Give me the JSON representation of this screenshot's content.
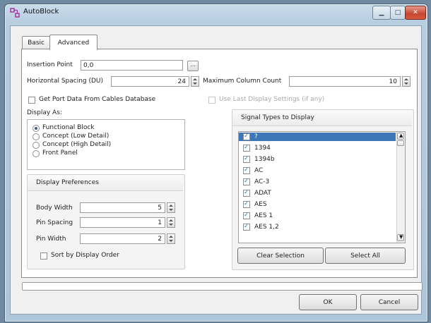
{
  "window": {
    "title": "AutoBlock"
  },
  "tabs": [
    {
      "label": "Basic",
      "active": false
    },
    {
      "label": "Advanced",
      "active": true
    }
  ],
  "insertion_point": {
    "label": "Insertion Point",
    "value": "0,0",
    "browse_label": "..."
  },
  "horizontal_spacing": {
    "label": "Horizontal Spacing (DU)",
    "value": "24"
  },
  "max_column_count": {
    "label": "Maximum Column Count",
    "value": "10"
  },
  "get_port_data": {
    "label": "Get Port Data From Cables Database",
    "checked": false
  },
  "use_last_display": {
    "label": "Use Last Display Settings (if any)",
    "checked": false,
    "enabled": false
  },
  "display_as": {
    "label": "Display As:",
    "options": [
      {
        "label": "Functional Block",
        "selected": true
      },
      {
        "label": "Concept (Low Detail)",
        "selected": false
      },
      {
        "label": "Concept (High Detail)",
        "selected": false
      },
      {
        "label": "Front Panel",
        "selected": false
      }
    ]
  },
  "display_preferences": {
    "title": "Display Preferences",
    "body_width": {
      "label": "Body Width",
      "value": "5"
    },
    "pin_spacing": {
      "label": "Pin Spacing",
      "value": "1"
    },
    "pin_width": {
      "label": "Pin Width",
      "value": "2"
    },
    "sort_by_order": {
      "label": "Sort by Display Order",
      "checked": false
    }
  },
  "signal_types": {
    "title": "Signal Types to Display",
    "items": [
      {
        "label": "?",
        "checked": true,
        "selected": true
      },
      {
        "label": "1394",
        "checked": true,
        "selected": false
      },
      {
        "label": "1394b",
        "checked": true,
        "selected": false
      },
      {
        "label": "AC",
        "checked": true,
        "selected": false
      },
      {
        "label": "AC-3",
        "checked": true,
        "selected": false
      },
      {
        "label": "ADAT",
        "checked": true,
        "selected": false
      },
      {
        "label": "AES",
        "checked": true,
        "selected": false
      },
      {
        "label": "AES 1",
        "checked": true,
        "selected": false
      },
      {
        "label": "AES 1,2",
        "checked": true,
        "selected": false
      }
    ],
    "clear_label": "Clear Selection",
    "select_all_label": "Select All"
  },
  "footer": {
    "ok_label": "OK",
    "cancel_label": "Cancel"
  },
  "colors": {
    "accent": "#3d77b8",
    "titlebar": "#b7cde0",
    "close": "#c7452f"
  }
}
